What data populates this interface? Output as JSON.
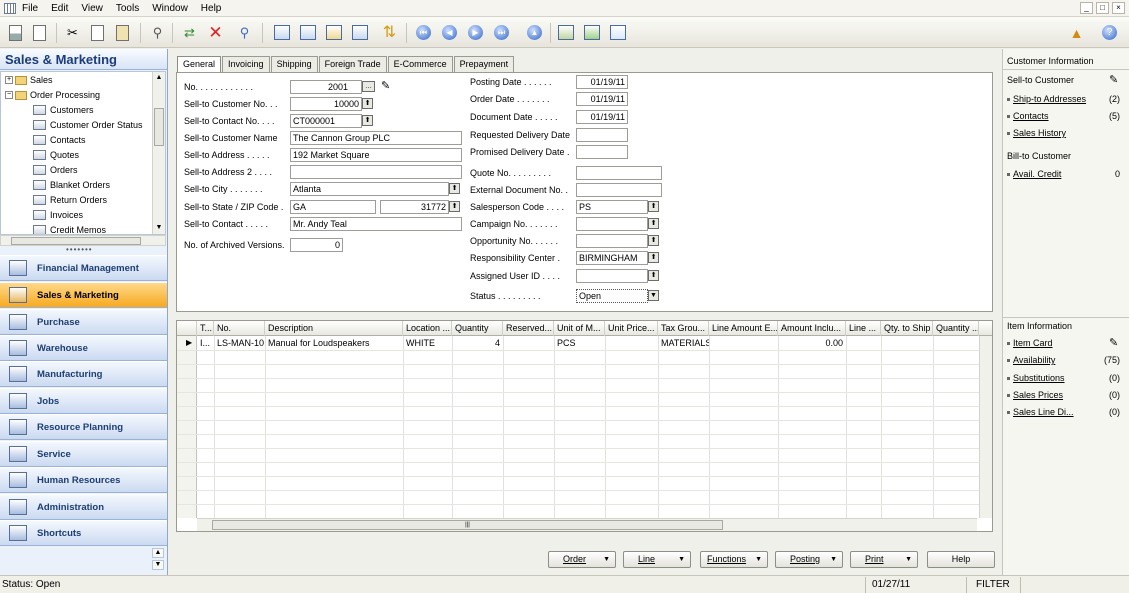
{
  "menu": [
    "File",
    "Edit",
    "View",
    "Tools",
    "Window",
    "Help"
  ],
  "window_controls": [
    "_",
    "□",
    "×"
  ],
  "nav_pane": {
    "title": "Sales & Marketing",
    "tree": [
      {
        "label": "Sales",
        "kind": "folder",
        "expander": "+"
      },
      {
        "label": "Order Processing",
        "kind": "folder",
        "expander": "−"
      },
      {
        "label": "Customers",
        "kind": "leaf"
      },
      {
        "label": "Customer Order Status",
        "kind": "leaf"
      },
      {
        "label": "Contacts",
        "kind": "leaf"
      },
      {
        "label": "Quotes",
        "kind": "leaf"
      },
      {
        "label": "Orders",
        "kind": "leaf"
      },
      {
        "label": "Blanket Orders",
        "kind": "leaf"
      },
      {
        "label": "Return Orders",
        "kind": "leaf"
      },
      {
        "label": "Invoices",
        "kind": "leaf"
      },
      {
        "label": "Credit Memos",
        "kind": "leaf"
      }
    ],
    "modules": [
      "Financial Management",
      "Sales & Marketing",
      "Purchase",
      "Warehouse",
      "Manufacturing",
      "Jobs",
      "Resource Planning",
      "Service",
      "Human Resources",
      "Administration",
      "Shortcuts"
    ],
    "active_module": "Sales & Marketing"
  },
  "tabs": [
    "General",
    "Invoicing",
    "Shipping",
    "Foreign Trade",
    "E-Commerce",
    "Prepayment"
  ],
  "active_tab": "General",
  "general": {
    "no_label": "No. . . . . . . . . . . .",
    "no_value": "2001",
    "sell_to_customer_no_label": "Sell-to Customer No. . .",
    "sell_to_customer_no": "10000",
    "sell_to_contact_no_label": "Sell-to Contact No. . . .",
    "sell_to_contact_no": "CT000001",
    "sell_to_customer_name_label": "Sell-to Customer Name",
    "sell_to_customer_name": "The Cannon Group PLC",
    "sell_to_address_label": "Sell-to Address . . . . .",
    "sell_to_address": "192 Market Square",
    "sell_to_address2_label": "Sell-to Address 2 . . . .",
    "sell_to_address2": "",
    "sell_to_city_label": "Sell-to City . . . . . . .",
    "sell_to_city": "Atlanta",
    "sell_to_state_zip_label": "Sell-to State / ZIP Code .",
    "sell_to_state": "GA",
    "sell_to_zip": "31772",
    "sell_to_contact_label": "Sell-to Contact . . . . .",
    "sell_to_contact": "Mr. Andy Teal",
    "archived_versions_label": "No. of Archived Versions.",
    "archived_versions": "0",
    "posting_date_label": "Posting Date . . . . . .",
    "posting_date": "01/19/11",
    "order_date_label": "Order Date . . . . . . .",
    "order_date": "01/19/11",
    "document_date_label": "Document Date . . . . .",
    "document_date": "01/19/11",
    "requested_delivery_label": "Requested Delivery Date",
    "requested_delivery": "",
    "promised_delivery_label": "Promised Delivery Date .",
    "promised_delivery": "",
    "quote_no_label": "Quote No. . . . . . . . .",
    "quote_no": "",
    "external_doc_label": "External Document No. .",
    "external_doc": "",
    "salesperson_label": "Salesperson Code . . . .",
    "salesperson": "PS",
    "campaign_label": "Campaign No. . . . . . .",
    "campaign": "",
    "opportunity_label": "Opportunity No. . . . . .",
    "opportunity": "",
    "responsibility_label": "Responsibility Center .",
    "responsibility": "BIRMINGHAM",
    "assigned_user_label": "Assigned User ID . . . .",
    "assigned_user": "",
    "status_label": "Status . . . . . . . . .",
    "status": "Open"
  },
  "lines": {
    "columns": [
      "T...",
      "No.",
      "Description",
      "Location ...",
      "Quantity",
      "Reserved...",
      "Unit of M...",
      "Unit Price...",
      "Tax Grou...",
      "Line Amount E...",
      "Amount Inclu...",
      "Line ...",
      "Qty. to Ship",
      "Quantity ..."
    ],
    "rows": [
      {
        "type": "I...",
        "no": "LS-MAN-10",
        "description": "Manual for Loudspeakers",
        "location": "WHITE",
        "quantity": "4",
        "reserved": "",
        "uom": "PCS",
        "unit_price": "",
        "tax_group": "MATERIALS",
        "line_amount": "",
        "amount_incl": "0.00",
        "line_disc": "",
        "qty_to_ship": "",
        "quantity2": ""
      }
    ]
  },
  "buttons": [
    "Order",
    "Line",
    "Functions",
    "Posting",
    "Print",
    "Help"
  ],
  "factbox": {
    "customer_title": "Customer Information",
    "customer_items": [
      {
        "label": "Sell-to Customer",
        "value": ""
      },
      {
        "label": "Ship-to Addresses",
        "value": "(2)"
      },
      {
        "label": "Contacts",
        "value": "(5)"
      },
      {
        "label": "Sales History",
        "value": ""
      }
    ],
    "billto_title": "Bill-to Customer",
    "billto_items": [
      {
        "label": "Avail. Credit",
        "value": "0"
      }
    ],
    "item_title": "Item Information",
    "item_items": [
      {
        "label": "Item Card",
        "value": ""
      },
      {
        "label": "Availability",
        "value": "(75)"
      },
      {
        "label": "Substitutions",
        "value": "(0)"
      },
      {
        "label": "Sales Prices",
        "value": "(0)"
      },
      {
        "label": "Sales Line Di...",
        "value": "(0)"
      }
    ]
  },
  "statusbar": {
    "status": "Status: Open",
    "date": "01/27/11",
    "filter": "FILTER"
  }
}
